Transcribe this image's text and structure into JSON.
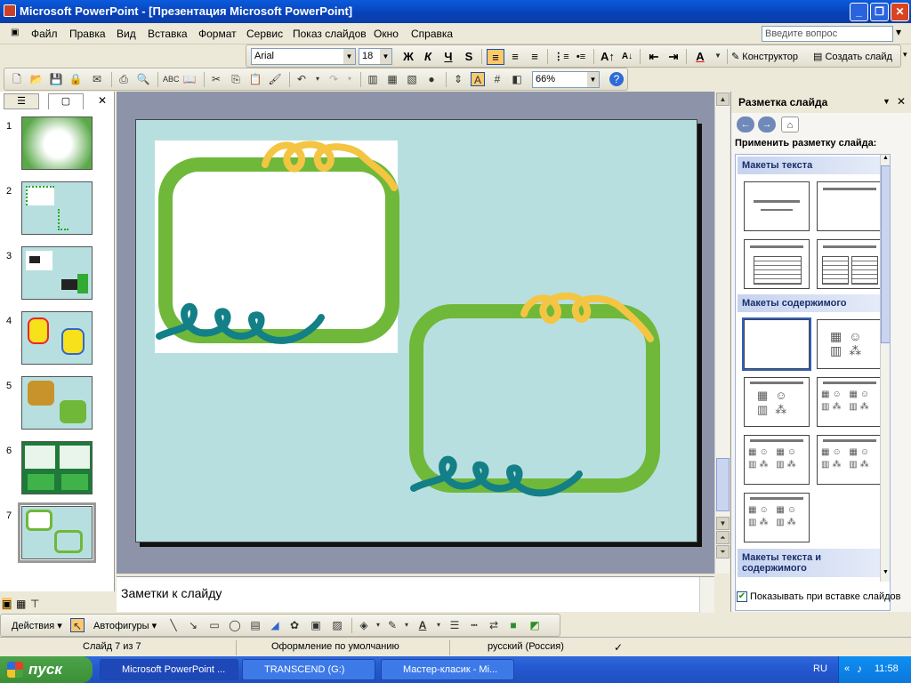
{
  "title": "Microsoft PowerPoint - [Презентация Microsoft PowerPoint]",
  "menu": [
    "Файл",
    "Правка",
    "Вид",
    "Вставка",
    "Формат",
    "Сервис",
    "Показ слайдов",
    "Окно",
    "Справка"
  ],
  "help_placeholder": "Введите вопрос",
  "format": {
    "font": "Arial",
    "size": "18",
    "bold": "Ж",
    "italic": "К",
    "underline": "Ч",
    "shadow": "S",
    "designer": "Конструктор",
    "new_slide": "Создать слайд",
    "font_color": "A"
  },
  "zoom": "66%",
  "slides": [
    "1",
    "2",
    "3",
    "4",
    "5",
    "6",
    "7"
  ],
  "notes_placeholder": "Заметки к слайду",
  "taskpane": {
    "title": "Разметка слайда",
    "apply_label": "Применить разметку слайда:",
    "section_text": "Макеты текста",
    "section_content": "Макеты содержимого",
    "section_text_content": "Макеты текста и содержимого",
    "show_on_insert": "Показывать при вставке слайдов"
  },
  "drawbar": {
    "actions": "Действия",
    "autoshapes": "Автофигуры"
  },
  "status": {
    "slide": "Слайд 7 из 7",
    "design": "Оформление по умолчанию",
    "lang": "русский (Россия)"
  },
  "taskbar": {
    "start": "пуск",
    "items": [
      "Microsoft PowerPoint ...",
      "TRANSCEND (G:)",
      "Мастер-класик - Mi..."
    ],
    "lang": "RU",
    "clock": "11:58"
  },
  "colors": {
    "title_blue": "#0a5bdc",
    "slide_bg": "#b8dfe0",
    "frame_green": "#6fb83a",
    "curl_yellow": "#f4c542",
    "curl_teal": "#137f86"
  }
}
